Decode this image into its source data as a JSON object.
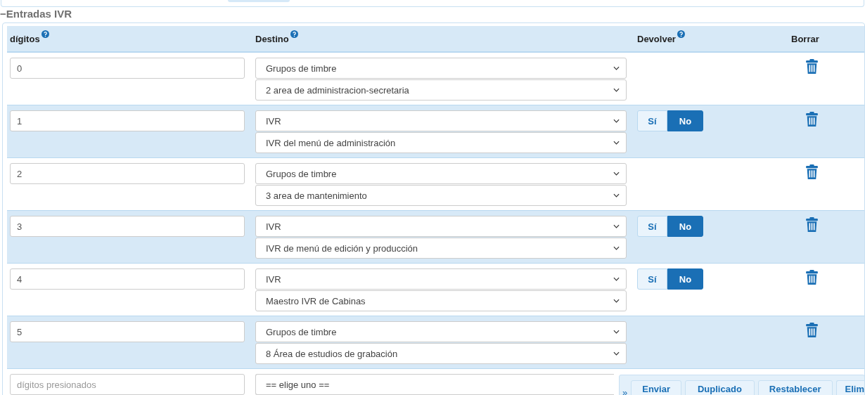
{
  "section": {
    "title": "Entradas IVR",
    "collapse_icon": "−"
  },
  "columns": [
    {
      "label": "dígitos",
      "help": true
    },
    {
      "label": "Destino",
      "help": true
    },
    {
      "label": "Devolver",
      "help": true
    },
    {
      "label": "Borrar",
      "help": false
    }
  ],
  "rows": [
    {
      "digits": "0",
      "destination": "Grupos de timbre",
      "target": "2 area de administracion-secretaria",
      "return": null
    },
    {
      "digits": "1",
      "destination": "IVR",
      "target": "IVR del menú de administración",
      "return": {
        "options": [
          {
            "label": "Sí",
            "selected": false
          },
          {
            "label": "No",
            "selected": true
          }
        ]
      }
    },
    {
      "digits": "2",
      "destination": "Grupos de timbre",
      "target": "3 area de mantenimiento",
      "return": null
    },
    {
      "digits": "3",
      "destination": "IVR",
      "target": "IVR de menú de edición y producción",
      "return": {
        "options": [
          {
            "label": "Sí",
            "selected": false
          },
          {
            "label": "No",
            "selected": true
          }
        ]
      }
    },
    {
      "digits": "4",
      "destination": "IVR",
      "target": "Maestro IVR de Cabinas",
      "return": {
        "options": [
          {
            "label": "Sí",
            "selected": false
          },
          {
            "label": "No",
            "selected": true
          }
        ]
      }
    },
    {
      "digits": "5",
      "destination": "Grupos de timbre",
      "target": "8 Área de estudios de grabación",
      "return": null
    }
  ],
  "new_row": {
    "placeholder": "dígitos presionados",
    "destination": "== elige uno =="
  },
  "action_bar": {
    "toggle": "»",
    "buttons": [
      "Enviar",
      "Duplicado",
      "Restablecer",
      "Elim"
    ]
  }
}
